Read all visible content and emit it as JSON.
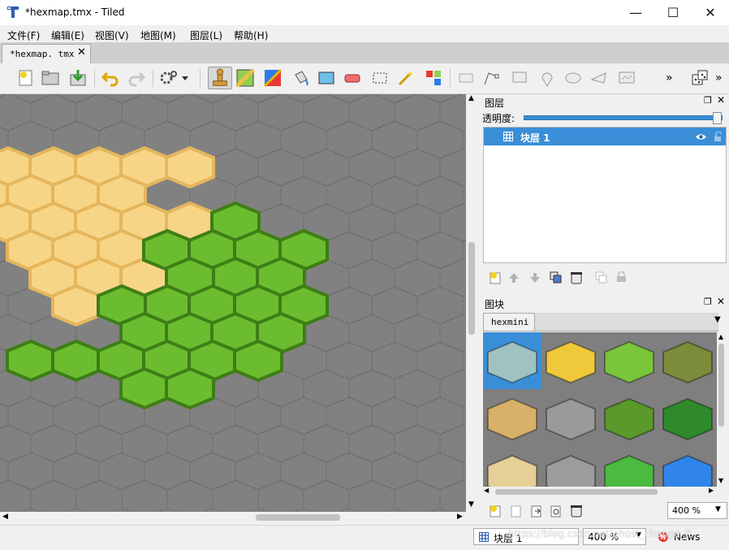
{
  "window": {
    "title": "*hexmap.tmx - Tiled",
    "minimize": "—",
    "maximize": "☐",
    "close": "✕"
  },
  "menu": [
    "文件(F)",
    "编辑(E)",
    "视图(V)",
    "地图(M)",
    "图层(L)",
    "帮助(H)"
  ],
  "tab": {
    "label": "*hexmap. tmx",
    "close": "✕"
  },
  "layers": {
    "title": "图层",
    "opacity_label": "透明度:",
    "opacity": 1.0,
    "items": [
      {
        "name": "块层 1",
        "visible": true,
        "locked": false
      }
    ]
  },
  "tilesets": {
    "title": "图块",
    "tab": "hexmini",
    "zoom": "400 %",
    "tiles": [
      {
        "name": "water",
        "color": "#9fc3c2"
      },
      {
        "name": "sand",
        "color": "#f0c93a"
      },
      {
        "name": "grass",
        "color": "#7ac63a"
      },
      {
        "name": "forest",
        "color": "#7b8c3b"
      },
      {
        "name": "desert-mountain",
        "color": "#d8b06a"
      },
      {
        "name": "stone-mountain",
        "color": "#9a9a9a"
      },
      {
        "name": "grass-hill",
        "color": "#5b9a2a"
      },
      {
        "name": "dark-forest",
        "color": "#2e8a2a"
      },
      {
        "name": "snow-mountain",
        "color": "#e7cf98"
      },
      {
        "name": "castle",
        "color": "#9c9c9c"
      },
      {
        "name": "light-grass",
        "color": "#4cba3e"
      },
      {
        "name": "deep-water",
        "color": "#2f86e8"
      }
    ]
  },
  "status": {
    "layer": "块层 1",
    "zoom": "400 %",
    "news": "News",
    "watermark": "https://blog.csdn.net/ghost_change_it"
  },
  "colors": {
    "sand_fill": "#f7d586",
    "sand_edge": "#e5b65c",
    "grass_fill": "#6bbd2f",
    "grass_edge": "#3e7e16",
    "grid": "#6a6a6a",
    "canvas": "#818181",
    "accent": "#3a8ed7"
  },
  "map": {
    "cols": 11,
    "rows": 16,
    "sand": [
      [
        0,
        3
      ],
      [
        1,
        3
      ],
      [
        2,
        3
      ],
      [
        3,
        3
      ],
      [
        4,
        3
      ],
      [
        0,
        4
      ],
      [
        1,
        4
      ],
      [
        2,
        4
      ],
      [
        3,
        4
      ],
      [
        0,
        5
      ],
      [
        1,
        5
      ],
      [
        2,
        5
      ],
      [
        3,
        5
      ],
      [
        4,
        5
      ],
      [
        1,
        6
      ],
      [
        2,
        6
      ],
      [
        3,
        6
      ],
      [
        4,
        6
      ],
      [
        1,
        7
      ],
      [
        2,
        7
      ],
      [
        3,
        7
      ],
      [
        2,
        8
      ]
    ],
    "grass": [
      [
        5,
        5
      ],
      [
        4,
        6
      ],
      [
        5,
        6
      ],
      [
        6,
        6
      ],
      [
        7,
        6
      ],
      [
        5,
        7
      ],
      [
        6,
        7
      ],
      [
        4,
        7
      ],
      [
        4,
        8
      ],
      [
        5,
        8
      ],
      [
        6,
        8
      ],
      [
        7,
        8
      ],
      [
        3,
        8
      ],
      [
        3,
        9
      ],
      [
        4,
        9
      ],
      [
        5,
        9
      ],
      [
        6,
        9
      ],
      [
        1,
        10
      ],
      [
        2,
        10
      ],
      [
        3,
        10
      ],
      [
        4,
        10
      ],
      [
        5,
        10
      ],
      [
        6,
        10
      ],
      [
        3,
        11
      ],
      [
        4,
        11
      ]
    ]
  }
}
